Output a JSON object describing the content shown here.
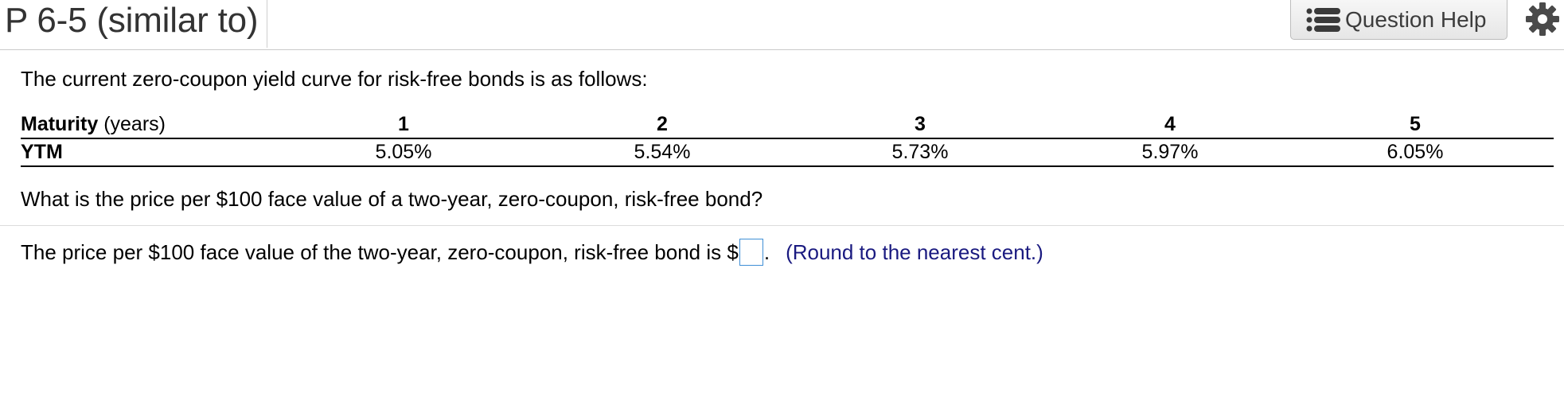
{
  "header": {
    "title": "P 6-5 (similar to)",
    "help_button_label": "Question Help",
    "help_icon": "list-icon",
    "settings_icon": "gear-icon",
    "help_icon_color": "#3a3a3a",
    "gear_color": "#4a4a4a"
  },
  "problem": {
    "intro": "The current zero-coupon yield curve for risk-free bonds is as follows:",
    "table": {
      "row1_header_bold": "Maturity",
      "row1_header_unit": "(years)",
      "row2_header": "YTM",
      "maturities": [
        "1",
        "2",
        "3",
        "4",
        "5"
      ],
      "ytms": [
        "5.05%",
        "5.54%",
        "5.73%",
        "5.97%",
        "6.05%"
      ]
    },
    "question": "What is the price per $100 face value of a two-year, zero-coupon, risk-free bond?",
    "answer_prefix": "The price per $100 face value of the two-year, zero-coupon, risk-free bond is $",
    "answer_value": "",
    "answer_suffix": ".",
    "hint": "(Round to the nearest cent.)",
    "hint_color": "#1a1a80",
    "input_border_color": "#3f8fd6"
  }
}
